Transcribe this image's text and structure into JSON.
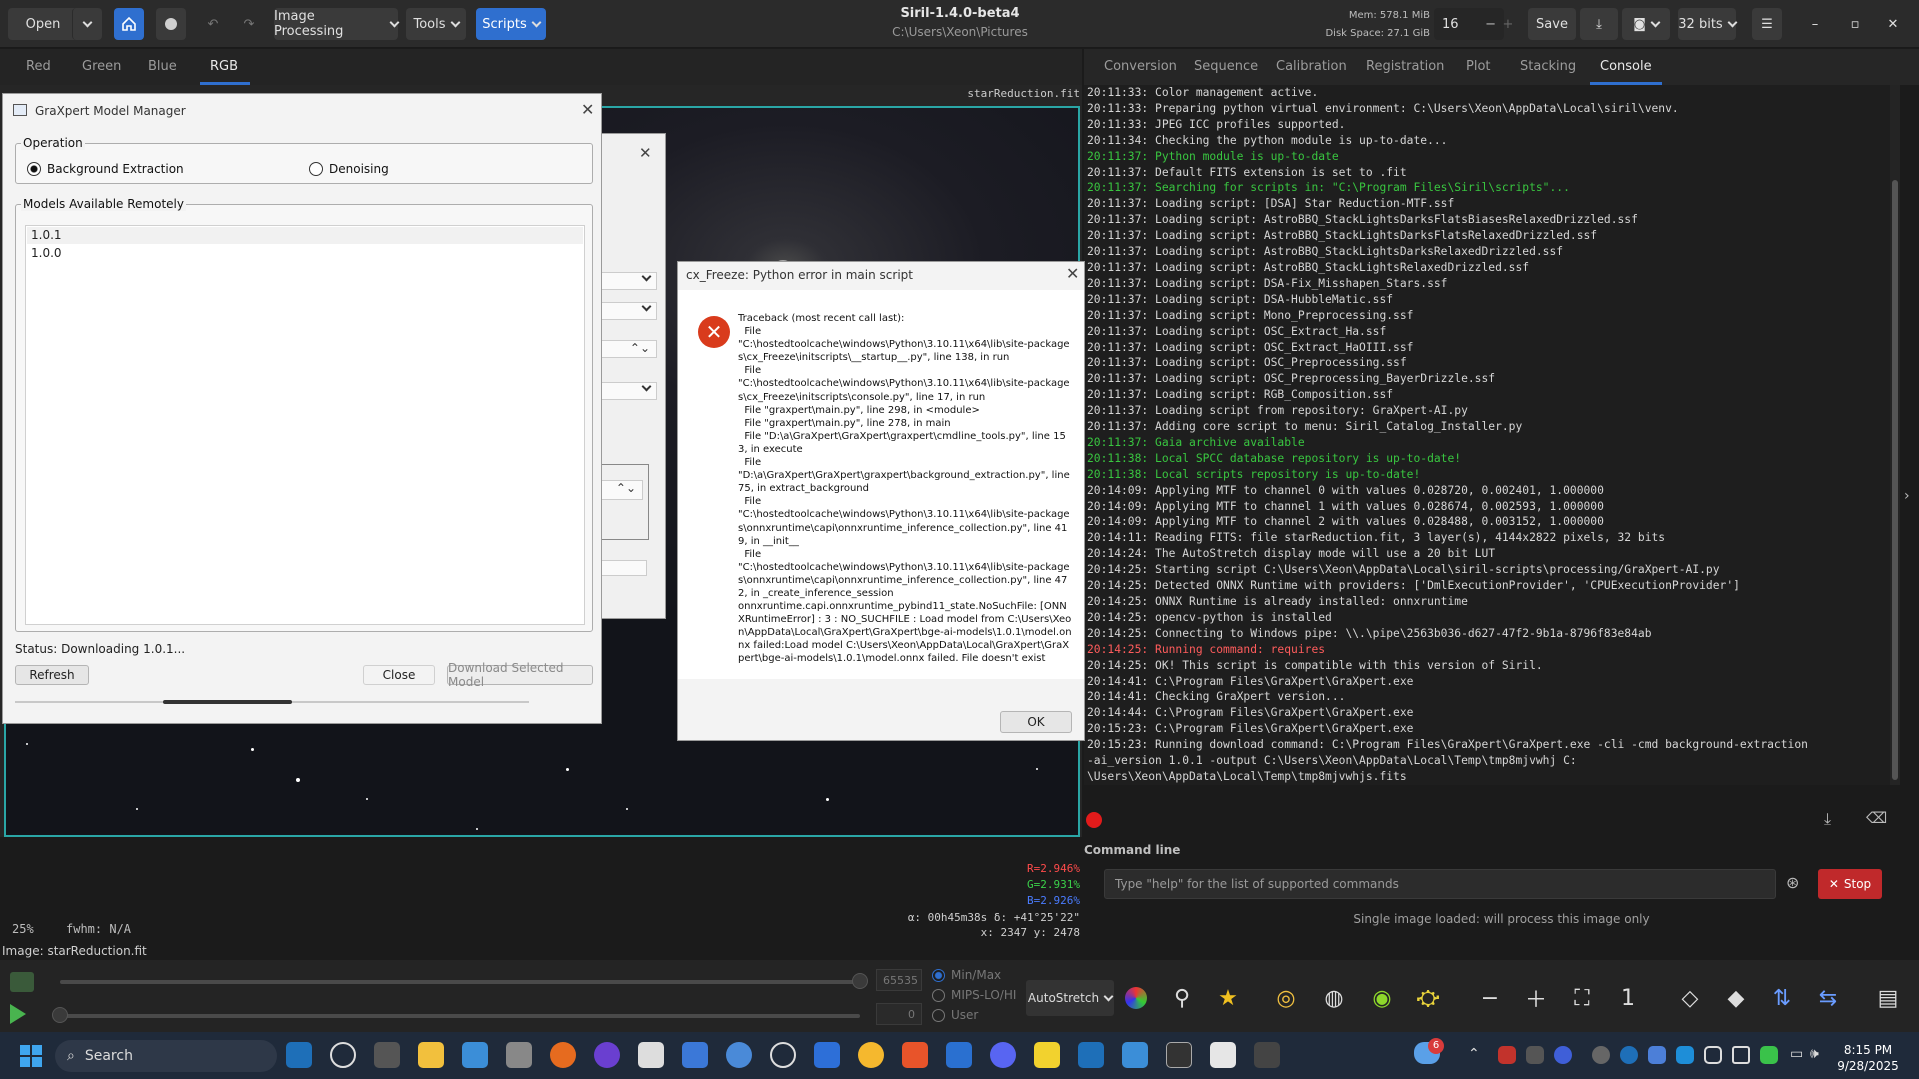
{
  "header": {
    "open_label": "Open",
    "image_processing_label": "Image Processing",
    "tools_label": "Tools",
    "scripts_label": "Scripts",
    "app_title": "Siril-1.4.0-beta4",
    "app_path": "C:\\Users\\Xeon\\Pictures",
    "mem": "Mem: 578.1 MiB",
    "disk": "Disk Space: 27.1 GiB",
    "threads_value": "16",
    "save_label": "Save",
    "bits_label": "32 bits"
  },
  "channel_tabs": [
    "Red",
    "Green",
    "Blue",
    "RGB"
  ],
  "active_channel": "RGB",
  "image_filename_overlay": "starReduction.fit",
  "right_tabs": [
    "Conversion",
    "Sequence",
    "Calibration",
    "Registration",
    "Plot",
    "Stacking",
    "Console"
  ],
  "active_right_tab": "Console",
  "console": {
    "lines": [
      {
        "t": "20:11:33: Color management active.",
        "c": ""
      },
      {
        "t": "20:11:33: Preparing python virtual environment: C:\\Users\\Xeon\\AppData\\Local\\siril\\venv.",
        "c": ""
      },
      {
        "t": "20:11:33: JPEG ICC profiles supported.",
        "c": ""
      },
      {
        "t": "20:11:34: Checking the python module is up-to-date...",
        "c": ""
      },
      {
        "t": "20:11:37: Python module is up-to-date",
        "c": "green"
      },
      {
        "t": "20:11:37: Default FITS extension is set to .fit",
        "c": ""
      },
      {
        "t": "20:11:37: Searching for scripts in: \"C:\\Program Files\\Siril\\scripts\"...",
        "c": "green"
      },
      {
        "t": "20:11:37: Loading script: [DSA] Star Reduction-MTF.ssf",
        "c": ""
      },
      {
        "t": "20:11:37: Loading script: AstroBBQ_StackLightsDarksFlatsBiasesRelaxedDrizzled.ssf",
        "c": ""
      },
      {
        "t": "20:11:37: Loading script: AstroBBQ_StackLightsDarksFlatsRelaxedDrizzled.ssf",
        "c": ""
      },
      {
        "t": "20:11:37: Loading script: AstroBBQ_StackLightsDarksRelaxedDrizzled.ssf",
        "c": ""
      },
      {
        "t": "20:11:37: Loading script: AstroBBQ_StackLightsRelaxedDrizzled.ssf",
        "c": ""
      },
      {
        "t": "20:11:37: Loading script: DSA-Fix_Misshapen_Stars.ssf",
        "c": ""
      },
      {
        "t": "20:11:37: Loading script: DSA-HubbleMatic.ssf",
        "c": ""
      },
      {
        "t": "20:11:37: Loading script: Mono_Preprocessing.ssf",
        "c": ""
      },
      {
        "t": "20:11:37: Loading script: OSC_Extract_Ha.ssf",
        "c": ""
      },
      {
        "t": "20:11:37: Loading script: OSC_Extract_HaOIII.ssf",
        "c": ""
      },
      {
        "t": "20:11:37: Loading script: OSC_Preprocessing.ssf",
        "c": ""
      },
      {
        "t": "20:11:37: Loading script: OSC_Preprocessing_BayerDrizzle.ssf",
        "c": ""
      },
      {
        "t": "20:11:37: Loading script: RGB_Composition.ssf",
        "c": ""
      },
      {
        "t": "20:11:37: Loading script from repository: GraXpert-AI.py",
        "c": ""
      },
      {
        "t": "20:11:37: Adding core script to menu: Siril_Catalog_Installer.py",
        "c": ""
      },
      {
        "t": "20:11:37: Gaia archive available",
        "c": "green"
      },
      {
        "t": "20:11:38: Local SPCC database repository is up-to-date!",
        "c": "green"
      },
      {
        "t": "20:11:38: Local scripts repository is up-to-date!",
        "c": "green"
      },
      {
        "t": "20:14:09: Applying MTF to channel 0 with values 0.028720, 0.002401, 1.000000",
        "c": ""
      },
      {
        "t": "20:14:09: Applying MTF to channel 1 with values 0.028674, 0.002593, 1.000000",
        "c": ""
      },
      {
        "t": "20:14:09: Applying MTF to channel 2 with values 0.028488, 0.003152, 1.000000",
        "c": ""
      },
      {
        "t": "20:14:11: Reading FITS: file starReduction.fit, 3 layer(s), 4144x2822 pixels, 32 bits",
        "c": ""
      },
      {
        "t": "20:14:24: The AutoStretch display mode will use a 20 bit LUT",
        "c": ""
      },
      {
        "t": "20:14:25: Starting script C:\\Users\\Xeon\\AppData\\Local\\siril-scripts\\processing/GraXpert-AI.py",
        "c": ""
      },
      {
        "t": "20:14:25: Detected ONNX Runtime with providers: ['DmlExecutionProvider', 'CPUExecutionProvider']",
        "c": ""
      },
      {
        "t": "20:14:25: ONNX Runtime is already installed: onnxruntime",
        "c": ""
      },
      {
        "t": "20:14:25: opencv-python is installed",
        "c": ""
      },
      {
        "t": "20:14:25: Connecting to Windows pipe: \\\\.\\pipe\\2563b036-d627-47f2-9b1a-8796f83e84ab",
        "c": ""
      },
      {
        "t": "20:14:25: Running command: requires",
        "c": "red"
      },
      {
        "t": "20:14:25: OK! This script is compatible with this version of Siril.",
        "c": ""
      },
      {
        "t": "20:14:41: C:\\Program Files\\GraXpert\\GraXpert.exe",
        "c": ""
      },
      {
        "t": "20:14:41: Checking GraXpert version...",
        "c": ""
      },
      {
        "t": "20:14:44: C:\\Program Files\\GraXpert\\GraXpert.exe",
        "c": ""
      },
      {
        "t": "20:15:23: C:\\Program Files\\GraXpert\\GraXpert.exe",
        "c": ""
      },
      {
        "t": "20:15:23: Running download command: C:\\Program Files\\GraXpert\\GraXpert.exe -cli -cmd background-extraction",
        "c": ""
      },
      {
        "t": "-ai_version 1.0.1 -output C:\\Users\\Xeon\\AppData\\Local\\Temp\\tmp8mjvwhj C:",
        "c": ""
      },
      {
        "t": "\\Users\\Xeon\\AppData\\Local\\Temp\\tmp8mjvwhjs.fits",
        "c": ""
      }
    ]
  },
  "command_line": {
    "label": "Command line",
    "placeholder": "Type \"help\" for the list of supported commands",
    "stop_label": "Stop",
    "status_message": "Single image loaded: will process this image only"
  },
  "image_info": {
    "zoom": "25%",
    "fwhm": "fwhm: N/A",
    "r_value": "R=2.946%",
    "g_value": "G=2.931%",
    "b_value": "B=2.926%",
    "ra_dec": "α: 00h45m38s δ: +41°25'22\"",
    "xy": "x: 2347 y: 2478",
    "image_name": "Image: starReduction.fit"
  },
  "lower_bar": {
    "high_value": "65535",
    "low_value": "0",
    "modes": [
      "Min/Max",
      "MIPS-LO/HI",
      "User"
    ],
    "selected_mode": "Min/Max",
    "display_mode": "AutoStretch"
  },
  "model_manager": {
    "title": "GraXpert Model Manager",
    "operation_label": "Operation",
    "op_background": "Background Extraction",
    "op_denoising": "Denoising",
    "selected_operation": "Background Extraction",
    "models_label": "Models Available Remotely",
    "models": [
      "1.0.1",
      "1.0.0"
    ],
    "status": "Status: Downloading 1.0.1...",
    "refresh_label": "Refresh",
    "close_label": "Close",
    "download_label": "Download Selected Model",
    "progress": 0.25
  },
  "error_dialog": {
    "title": "cx_Freeze: Python error in main script",
    "text": "Traceback (most recent call last):\n  File\n\"C:\\hostedtoolcache\\windows\\Python\\3.10.11\\x64\\lib\\site-packages\\cx_Freeze\\initscripts\\__startup__.py\", line 138, in run\n  File\n\"C:\\hostedtoolcache\\windows\\Python\\3.10.11\\x64\\lib\\site-packages\\cx_Freeze\\initscripts\\console.py\", line 17, in run\n  File \"graxpert\\main.py\", line 298, in <module>\n  File \"graxpert\\main.py\", line 278, in main\n  File \"D:\\a\\GraXpert\\GraXpert\\graxpert\\cmdline_tools.py\", line 153, in execute\n  File\n\"D:\\a\\GraXpert\\GraXpert\\graxpert\\background_extraction.py\", line 75, in extract_background\n  File\n\"C:\\hostedtoolcache\\windows\\Python\\3.10.11\\x64\\lib\\site-packages\\onnxruntime\\capi\\onnxruntime_inference_collection.py\", line 419, in __init__\n  File\n\"C:\\hostedtoolcache\\windows\\Python\\3.10.11\\x64\\lib\\site-packages\\onnxruntime\\capi\\onnxruntime_inference_collection.py\", line 472, in _create_inference_session\nonnxruntime.capi.onnxruntime_pybind11_state.NoSuchFile: [ONNXRuntimeError] : 3 : NO_SUCHFILE : Load model from C:\\Users\\Xeon\\AppData\\Local\\GraXpert\\GraXpert\\bge-ai-models\\1.0.1\\model.onnx failed:Load model C:\\Users\\Xeon\\AppData\\Local\\GraXpert\\GraXpert\\bge-ai-models\\1.0.1\\model.onnx failed. File doesn't exist",
    "ok_label": "OK"
  },
  "taskbar": {
    "search_label": "Search",
    "time": "8:15 PM",
    "date": "9/28/2025",
    "notification_count": "6"
  },
  "colors": {
    "accent": "#2f6fcf",
    "stop": "#c0292b",
    "console_green": "#39c640",
    "console_red": "#ff5c5c",
    "r_value": "#ff4b4b",
    "g_value": "#3bd14a",
    "b_value": "#4a7cff"
  }
}
